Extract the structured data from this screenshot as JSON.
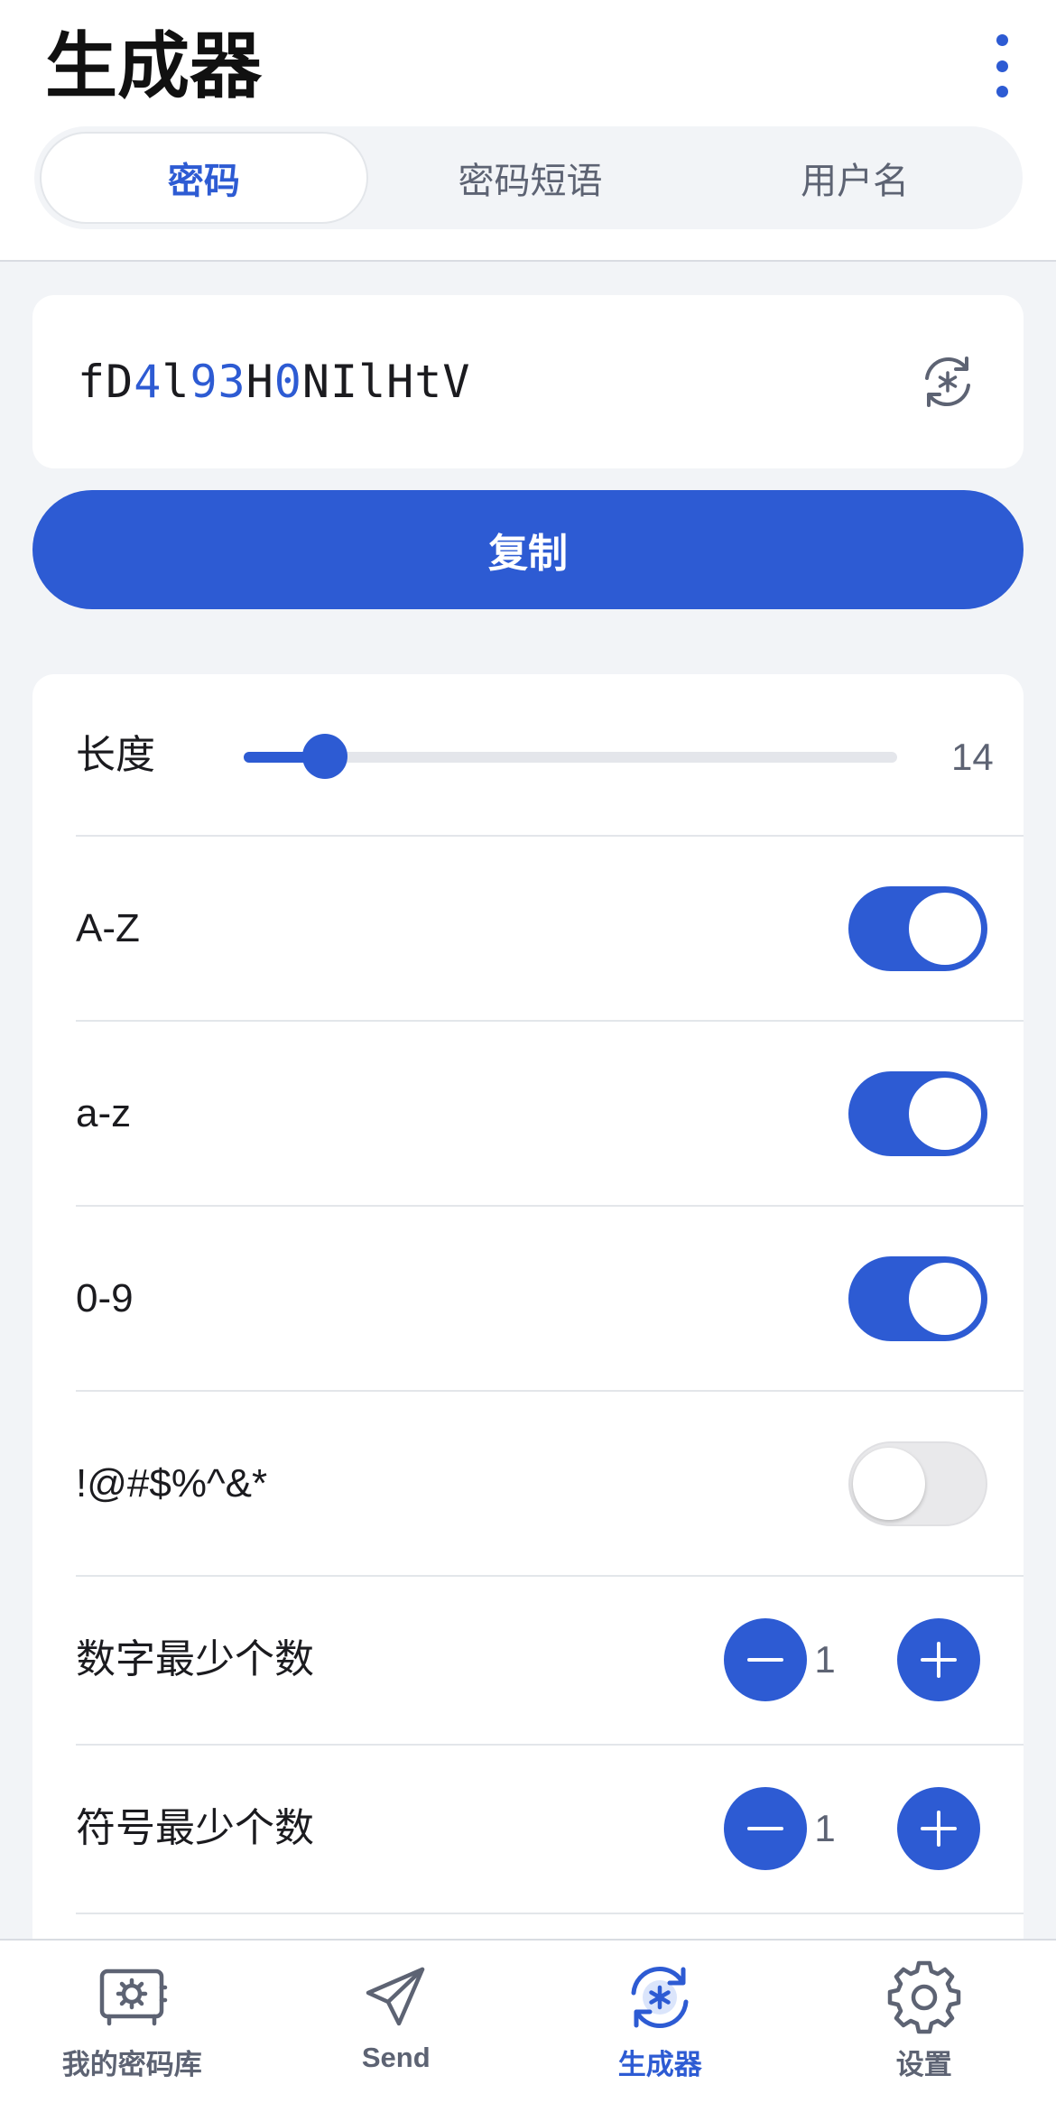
{
  "header": {
    "title": "生成器",
    "tabs": [
      {
        "label": "密码",
        "active": true
      },
      {
        "label": "密码短语",
        "active": false
      },
      {
        "label": "用户名",
        "active": false
      }
    ]
  },
  "password": {
    "segments": [
      {
        "text": "fD",
        "type": "letter"
      },
      {
        "text": "4",
        "type": "number"
      },
      {
        "text": "l",
        "type": "letter"
      },
      {
        "text": "93",
        "type": "number"
      },
      {
        "text": "H",
        "type": "letter"
      },
      {
        "text": "0",
        "type": "number"
      },
      {
        "text": "NIlHtV",
        "type": "letter"
      }
    ],
    "regenerate_icon": "regenerate-icon"
  },
  "copy_label": "复制",
  "options": {
    "length": {
      "label": "长度",
      "value": "14",
      "fraction": 0.105
    },
    "uppercase": {
      "label": "A-Z",
      "enabled": true
    },
    "lowercase": {
      "label": "a-z",
      "enabled": true
    },
    "numbers": {
      "label": "0-9",
      "enabled": true
    },
    "special": {
      "label": "!@#$%^&*",
      "enabled": false
    },
    "min_numbers": {
      "label": "数字最少个数",
      "value": "1"
    },
    "min_special": {
      "label": "符号最少个数",
      "value": "1"
    }
  },
  "tabbar": [
    {
      "label": "我的密码库",
      "icon": "vault-icon",
      "active": false
    },
    {
      "label": "Send",
      "icon": "send-icon",
      "active": false
    },
    {
      "label": "生成器",
      "icon": "generator-icon",
      "active": true
    },
    {
      "label": "设置",
      "icon": "gear-icon",
      "active": false
    }
  ],
  "colors": {
    "accent": "#2d5bd3",
    "background": "#f2f4f7",
    "muted": "#5d6373"
  }
}
